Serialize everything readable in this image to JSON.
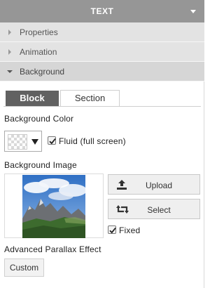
{
  "header": {
    "title": "TEXT"
  },
  "sections": {
    "properties": "Properties",
    "animation": "Animation",
    "background": "Background"
  },
  "tabs": {
    "block": "Block",
    "section": "Section",
    "active": "Block"
  },
  "background_color": {
    "label": "Background Color",
    "fluid_label": "Fluid (full screen)",
    "fluid_checked": true
  },
  "background_image": {
    "label": "Background Image",
    "upload_label": "Upload",
    "select_label": "Select",
    "fixed_label": "Fixed",
    "fixed_checked": true
  },
  "parallax": {
    "label": "Advanced Parallax Effect",
    "custom_label": "Custom"
  },
  "colors": {
    "header_bg": "#969696",
    "active_tab_bg": "#616161",
    "section_bg": "#e3e3e3"
  }
}
